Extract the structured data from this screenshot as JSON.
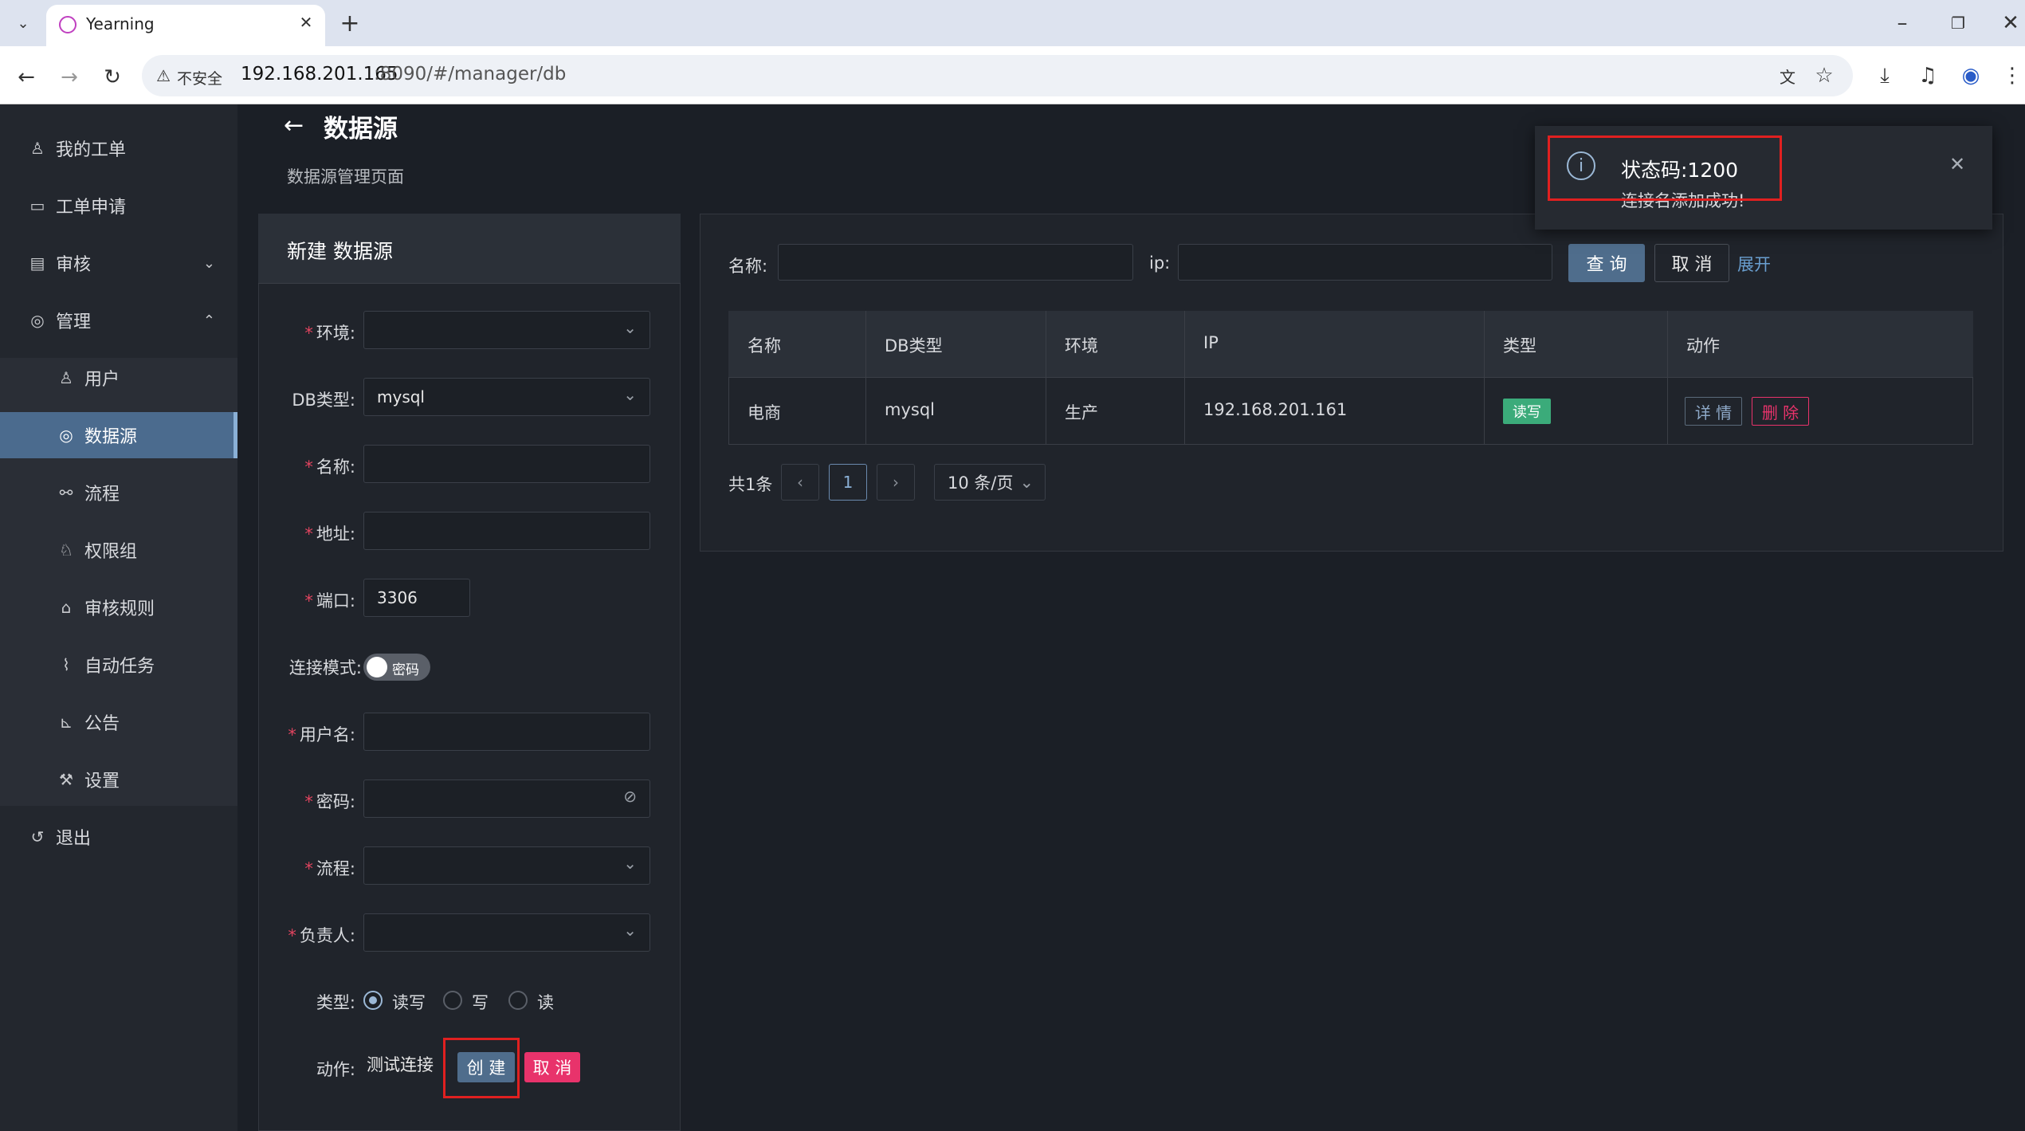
{
  "browser": {
    "tab_title": "Yearning",
    "tab_new": "+",
    "insecure_label": "不安全",
    "url_host": "192.168.201.165",
    "url_rest": ":8090/#/manager/db"
  },
  "sidebar": {
    "my_orders": "我的工单",
    "apply": "工单申请",
    "audit": "审核",
    "manage": "管理",
    "sub": {
      "users": "用户",
      "datasource": "数据源",
      "flow": "流程",
      "perm_group": "权限组",
      "audit_rules": "审核规则",
      "auto_task": "自动任务",
      "notice": "公告",
      "settings": "设置"
    },
    "logout": "退出"
  },
  "page": {
    "title": "数据源",
    "subtitle": "数据源管理页面"
  },
  "form": {
    "title": "新建 数据源",
    "env_label": "环境:",
    "dbtype_label": "DB类型:",
    "dbtype_value": "mysql",
    "name_label": "名称:",
    "addr_label": "地址:",
    "port_label": "端口:",
    "port_value": "3306",
    "mode_label": "连接模式:",
    "mode_value": "密码",
    "user_label": "用户名:",
    "pwd_label": "密码:",
    "flow_label": "流程:",
    "owner_label": "负责人:",
    "type_label": "类型:",
    "type_opts": [
      "读写",
      "写",
      "读"
    ],
    "action_label": "动作:",
    "btn_test": "测试连接",
    "btn_create": "创 建",
    "btn_cancel": "取 消"
  },
  "search": {
    "name_label": "名称:",
    "ip_label": "ip:",
    "btn_query": "查 询",
    "btn_reset": "取 消",
    "expand": "展开"
  },
  "table": {
    "headers": [
      "名称",
      "DB类型",
      "环境",
      "IP",
      "类型",
      "动作"
    ],
    "row": {
      "name": "电商",
      "dbtype": "mysql",
      "env": "生产",
      "ip": "192.168.201.161",
      "type": "读写",
      "detail": "详 情",
      "delete": "删 除"
    }
  },
  "pagination": {
    "total": "共1条",
    "current": "1",
    "page_size": "10 条/页"
  },
  "toast": {
    "title": "状态码:1200",
    "message": "连接名添加成功!"
  }
}
